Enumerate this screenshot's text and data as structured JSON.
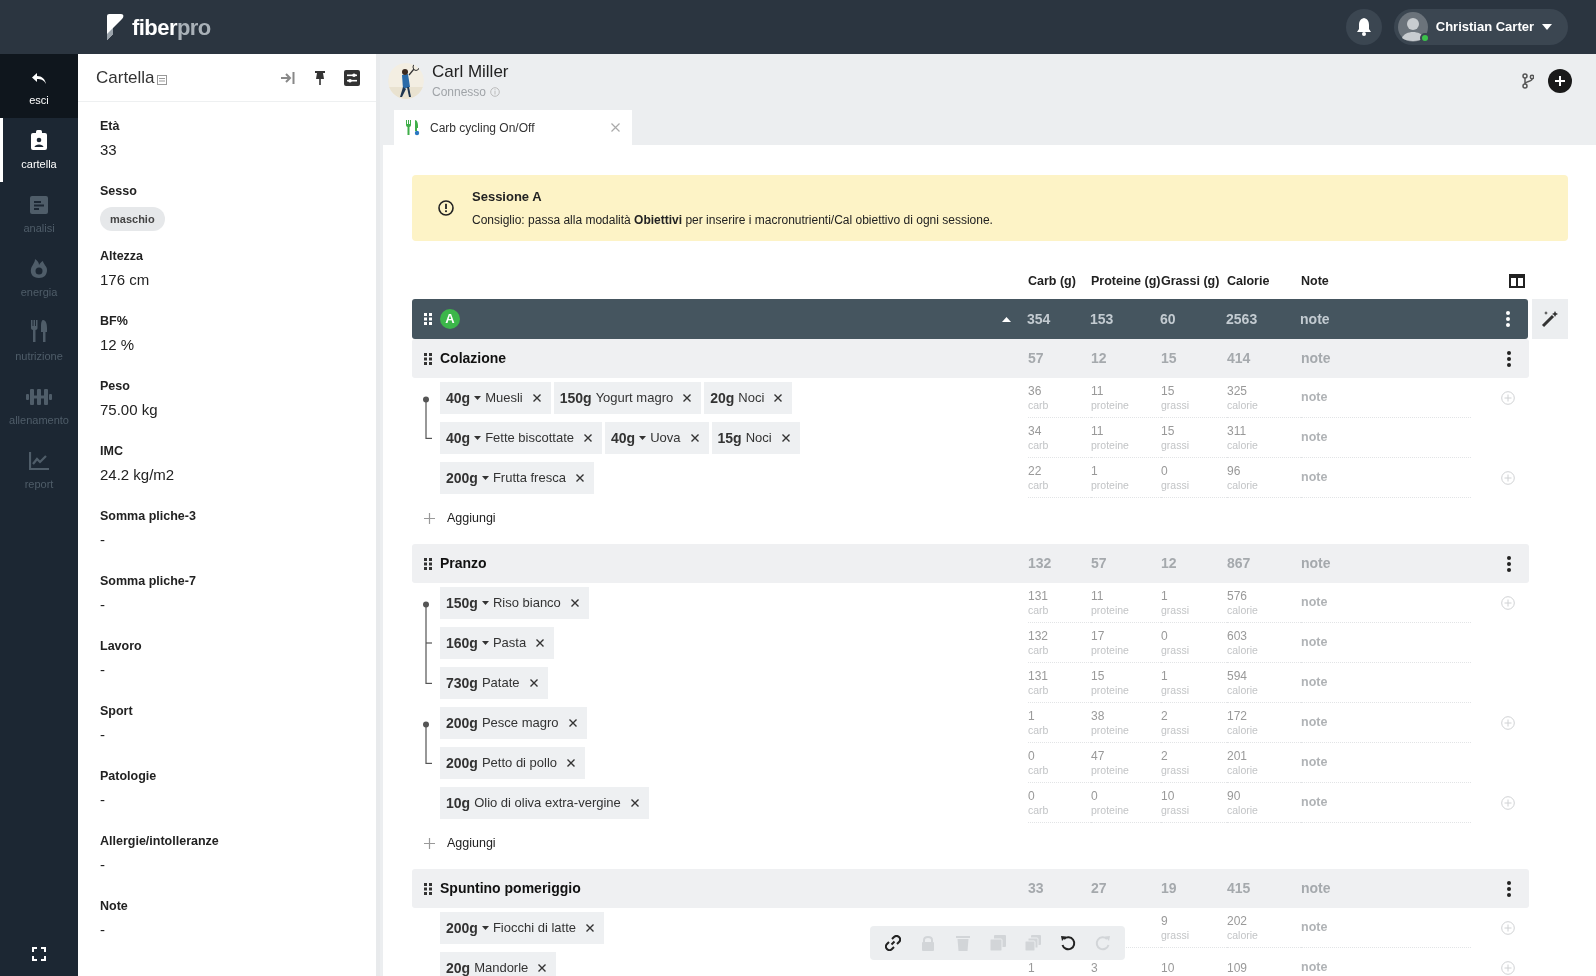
{
  "header": {
    "logo": {
      "primary": "fiber",
      "secondary": "pro"
    },
    "user": {
      "name": "Christian Carter",
      "online": true
    }
  },
  "exit_button": {
    "label": "esci"
  },
  "nav": [
    {
      "kind": "folder",
      "label": "cartella",
      "selected": true
    },
    {
      "kind": "analysis",
      "label": "analisi",
      "selected": false
    },
    {
      "kind": "energy",
      "label": "energia",
      "selected": false
    },
    {
      "kind": "nutrition",
      "label": "nutrizione",
      "selected": false
    },
    {
      "kind": "training",
      "label": "allenamento",
      "selected": false
    },
    {
      "kind": "report",
      "label": "report",
      "selected": false
    }
  ],
  "panel": {
    "title": "Cartella",
    "fields": [
      {
        "label": "Età",
        "value": "33",
        "kind": "text"
      },
      {
        "label": "Sesso",
        "value": "maschio",
        "kind": "chip"
      },
      {
        "label": "Altezza",
        "value": "176 cm",
        "kind": "text"
      },
      {
        "label": "BF%",
        "value": "12 %",
        "kind": "text"
      },
      {
        "label": "Peso",
        "value": "75.00 kg",
        "kind": "text"
      },
      {
        "label": "IMC",
        "value": "24.2 kg/m2",
        "kind": "text"
      },
      {
        "label": "Somma pliche-3",
        "value": "-",
        "kind": "text"
      },
      {
        "label": "Somma pliche-7",
        "value": "-",
        "kind": "text"
      },
      {
        "label": "Lavoro",
        "value": "-",
        "kind": "text"
      },
      {
        "label": "Sport",
        "value": "-",
        "kind": "text"
      },
      {
        "label": "Patologie",
        "value": "-",
        "kind": "text"
      },
      {
        "label": "Allergie/intolleranze",
        "value": "-",
        "kind": "text"
      },
      {
        "label": "Note",
        "value": "-",
        "kind": "text"
      }
    ]
  },
  "patient": {
    "name": "Carl Miller",
    "status": "Connesso"
  },
  "tabs": [
    {
      "label": "Carb cycling On/Off",
      "selected": true
    }
  ],
  "alert": {
    "title": "Sessione A",
    "text": "Consiglio: passa alla modalità **Obiettivi** per inserire i macronutrienti/Cal obiettivo di ogni sessione."
  },
  "table": {
    "columns": [
      "Carb (g)",
      "Proteine (g)",
      "Grassi (g)",
      "Calorie",
      "Note"
    ],
    "session": {
      "badge": "A",
      "expanded": true,
      "totals": [
        "354",
        "153",
        "60",
        "2563"
      ],
      "note": "note"
    },
    "meals": [
      {
        "name": "Colazione",
        "totals": [
          "57",
          "12",
          "15",
          "414"
        ],
        "note": "note",
        "add_label": "Aggiungi",
        "rows": [
          {
            "kind": "group-start",
            "add_button": true,
            "foods": [
              {
                "qty": "40g",
                "name": "Muesli",
                "dropdown": true
              },
              {
                "qty": "150g",
                "name": "Yogurt magro",
                "dropdown": false
              },
              {
                "qty": "20g",
                "name": "Noci",
                "dropdown": false
              }
            ],
            "cells": [
              {
                "value": "36",
                "unit": "carb"
              },
              {
                "value": "11",
                "unit": "proteine"
              },
              {
                "value": "15",
                "unit": "grassi"
              },
              {
                "value": "325",
                "unit": "calorie"
              }
            ],
            "note": "note"
          },
          {
            "kind": "group-end",
            "add_button": false,
            "foods": [
              {
                "qty": "40g",
                "name": "Fette biscottate",
                "dropdown": true
              },
              {
                "qty": "40g",
                "name": "Uova",
                "dropdown": true
              },
              {
                "qty": "15g",
                "name": "Noci",
                "dropdown": false
              }
            ],
            "cells": [
              {
                "value": "34",
                "unit": "carb"
              },
              {
                "value": "11",
                "unit": "proteine"
              },
              {
                "value": "15",
                "unit": "grassi"
              },
              {
                "value": "311",
                "unit": "calorie"
              }
            ],
            "note": "note"
          },
          {
            "kind": "single",
            "add_button": true,
            "foods": [
              {
                "qty": "200g",
                "name": "Frutta fresca",
                "dropdown": true
              }
            ],
            "cells": [
              {
                "value": "22",
                "unit": "carb"
              },
              {
                "value": "1",
                "unit": "proteine"
              },
              {
                "value": "0",
                "unit": "grassi"
              },
              {
                "value": "96",
                "unit": "calorie"
              }
            ],
            "note": "note"
          }
        ]
      },
      {
        "name": "Pranzo",
        "totals": [
          "132",
          "57",
          "12",
          "867"
        ],
        "note": "note",
        "add_label": "Aggiungi",
        "rows": [
          {
            "kind": "group-start",
            "add_button": true,
            "foods": [
              {
                "qty": "150g",
                "name": "Riso bianco",
                "dropdown": true
              }
            ],
            "cells": [
              {
                "value": "131",
                "unit": "carb"
              },
              {
                "value": "11",
                "unit": "proteine"
              },
              {
                "value": "1",
                "unit": "grassi"
              },
              {
                "value": "576",
                "unit": "calorie"
              }
            ],
            "note": "note"
          },
          {
            "kind": "group-middle",
            "add_button": false,
            "foods": [
              {
                "qty": "160g",
                "name": "Pasta",
                "dropdown": true
              }
            ],
            "cells": [
              {
                "value": "132",
                "unit": "carb"
              },
              {
                "value": "17",
                "unit": "proteine"
              },
              {
                "value": "0",
                "unit": "grassi"
              },
              {
                "value": "603",
                "unit": "calorie"
              }
            ],
            "note": "note"
          },
          {
            "kind": "group-end",
            "add_button": false,
            "foods": [
              {
                "qty": "730g",
                "name": "Patate",
                "dropdown": false
              }
            ],
            "cells": [
              {
                "value": "131",
                "unit": "carb"
              },
              {
                "value": "15",
                "unit": "proteine"
              },
              {
                "value": "1",
                "unit": "grassi"
              },
              {
                "value": "594",
                "unit": "calorie"
              }
            ],
            "note": "note"
          },
          {
            "kind": "group-start",
            "add_button": true,
            "foods": [
              {
                "qty": "200g",
                "name": "Pesce magro",
                "dropdown": false
              }
            ],
            "cells": [
              {
                "value": "1",
                "unit": "carb"
              },
              {
                "value": "38",
                "unit": "proteine"
              },
              {
                "value": "2",
                "unit": "grassi"
              },
              {
                "value": "172",
                "unit": "calorie"
              }
            ],
            "note": "note"
          },
          {
            "kind": "group-end",
            "add_button": false,
            "foods": [
              {
                "qty": "200g",
                "name": "Petto di pollo",
                "dropdown": false
              }
            ],
            "cells": [
              {
                "value": "0",
                "unit": "carb"
              },
              {
                "value": "47",
                "unit": "proteine"
              },
              {
                "value": "2",
                "unit": "grassi"
              },
              {
                "value": "201",
                "unit": "calorie"
              }
            ],
            "note": "note"
          },
          {
            "kind": "single",
            "add_button": true,
            "foods": [
              {
                "qty": "10g",
                "name": "Olio di oliva extra-vergine",
                "dropdown": false
              }
            ],
            "cells": [
              {
                "value": "0",
                "unit": "carb"
              },
              {
                "value": "0",
                "unit": "proteine"
              },
              {
                "value": "10",
                "unit": "grassi"
              },
              {
                "value": "90",
                "unit": "calorie"
              }
            ],
            "note": "note"
          }
        ]
      },
      {
        "name": "Spuntino pomeriggio",
        "totals": [
          "33",
          "27",
          "19",
          "415"
        ],
        "note": "note",
        "rows": [
          {
            "kind": "single",
            "add_button": true,
            "foods": [
              {
                "qty": "200g",
                "name": "Fiocchi di latte",
                "dropdown": true
              }
            ],
            "cells": [
              null,
              null,
              {
                "value": "9",
                "unit": "grassi"
              },
              {
                "value": "202",
                "unit": "calorie"
              }
            ],
            "note": "note"
          },
          {
            "kind": "single",
            "add_button": true,
            "foods": [
              {
                "qty": "20g",
                "name": "Mandorle",
                "dropdown": false
              }
            ],
            "cells": [
              {
                "value": "1"
              },
              {
                "value": "3"
              },
              {
                "value": "10"
              },
              {
                "value": "109"
              }
            ],
            "note": "note"
          }
        ]
      }
    ]
  },
  "toolbar": [
    {
      "kind": "link",
      "disabled": false
    },
    {
      "kind": "lock",
      "disabled": true
    },
    {
      "kind": "trash",
      "disabled": true
    },
    {
      "kind": "copy",
      "disabled": true
    },
    {
      "kind": "duplicate",
      "disabled": true
    },
    {
      "kind": "undo",
      "disabled": false
    },
    {
      "kind": "redo",
      "disabled": true
    }
  ]
}
